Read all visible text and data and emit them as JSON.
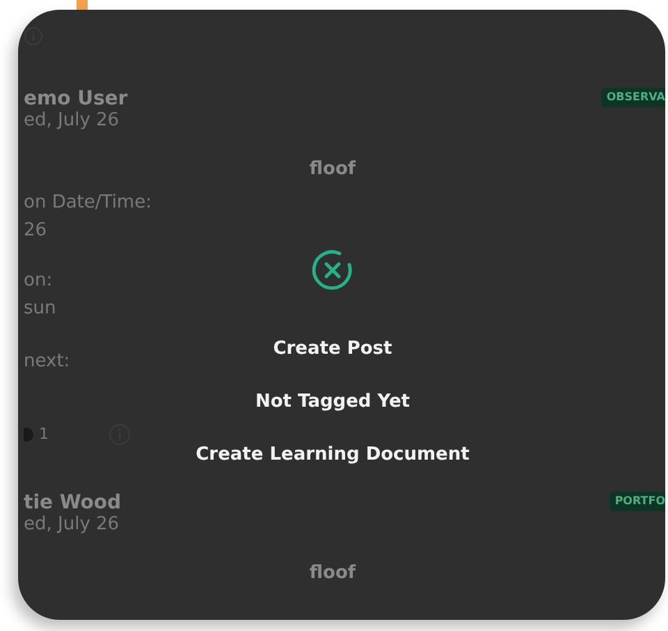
{
  "feed": {
    "posts": [
      {
        "author": "emo User",
        "date": "ed, July 26",
        "badge": "OBSERVA",
        "caption": "floof",
        "fields": [
          {
            "label": "on Date/Time:",
            "value": "26"
          },
          {
            "label": "on:",
            "value": "sun"
          },
          {
            "label": "next:"
          }
        ],
        "count": "1"
      },
      {
        "author": "tie Wood",
        "date": "ed, July 26",
        "badge": "PORTFO",
        "caption": "floof"
      }
    ]
  },
  "action_menu": {
    "items": [
      {
        "label": "Create Post"
      },
      {
        "label": "Not Tagged Yet"
      },
      {
        "label": "Create Learning Document"
      }
    ]
  }
}
